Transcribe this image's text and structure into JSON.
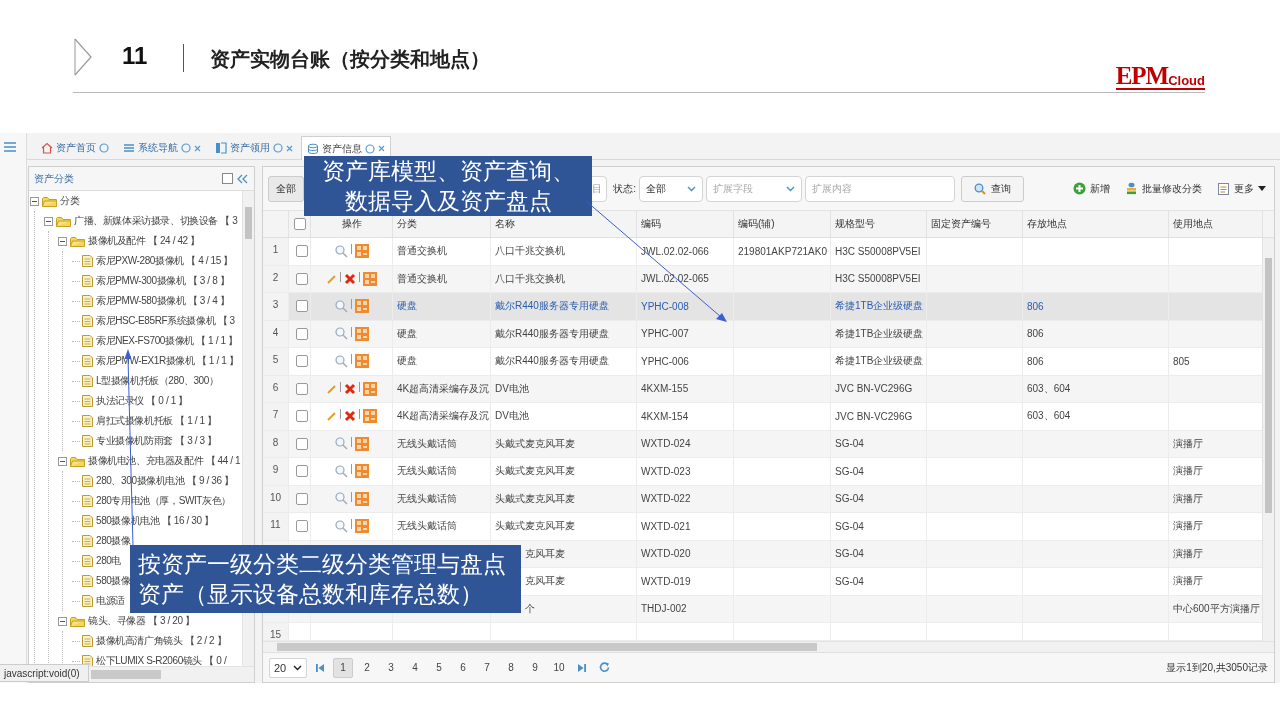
{
  "slide": {
    "number": "11",
    "title": "资产实物台账（按分类和地点）",
    "logo": {
      "main": "EPM",
      "sub": "Cloud"
    }
  },
  "app": {
    "tabs": [
      {
        "label": "资产首页",
        "closable": false,
        "selected": false
      },
      {
        "label": "系统导航",
        "closable": true,
        "selected": false
      },
      {
        "label": "资产领用",
        "closable": true,
        "selected": false
      },
      {
        "label": "资产信息",
        "closable": true,
        "selected": true
      }
    ],
    "tree_panel": {
      "title": "资产分类",
      "tree": [
        {
          "label": "分类",
          "kind": "folder",
          "expanded": true,
          "children": [
            {
              "label": "广播、新媒体采访摄录、切换设备 【 3",
              "kind": "folder",
              "expanded": true,
              "children": [
                {
                  "label": "摄像机及配件 【 24 / 42 】",
                  "kind": "folder",
                  "expanded": true,
                  "children": [
                    {
                      "label": "索尼PXW-280摄像机 【 4 / 15 】",
                      "kind": "file"
                    },
                    {
                      "label": "索尼PMW-300摄像机 【 3 / 8 】",
                      "kind": "file"
                    },
                    {
                      "label": "索尼PMW-580摄像机 【 3 / 4 】",
                      "kind": "file"
                    },
                    {
                      "label": "索尼HSC-E85RF系统摄像机 【 3",
                      "kind": "file"
                    },
                    {
                      "label": "索尼NEX-FS700摄像机 【 1 / 1 】",
                      "kind": "file"
                    },
                    {
                      "label": "索尼PMW-EX1R摄像机 【 1 / 1 】",
                      "kind": "file"
                    },
                    {
                      "label": "L型摄像机托板（280、300）",
                      "kind": "file"
                    },
                    {
                      "label": "执法记录仪 【 0 / 1 】",
                      "kind": "file"
                    },
                    {
                      "label": "肩扛式摄像机托板 【 1 / 1 】",
                      "kind": "file"
                    },
                    {
                      "label": "专业摄像机防雨套 【 3 / 3 】",
                      "kind": "file"
                    }
                  ]
                },
                {
                  "label": "摄像机电池、充电器及配件 【 44 / 1",
                  "kind": "folder",
                  "expanded": true,
                  "children": [
                    {
                      "label": "280、300摄像机电池 【 9 / 36 】",
                      "kind": "file"
                    },
                    {
                      "label": "280专用电池（厚，SWIT灰色）",
                      "kind": "file"
                    },
                    {
                      "label": "580摄像机电池 【 16 / 30 】",
                      "kind": "file"
                    },
                    {
                      "label": "280摄像",
                      "kind": "file"
                    },
                    {
                      "label": "280电",
                      "kind": "file"
                    },
                    {
                      "label": "580摄像",
                      "kind": "file"
                    },
                    {
                      "label": "电源适",
                      "kind": "file"
                    }
                  ]
                },
                {
                  "label": "镜头、寻像器 【 3 / 20 】",
                  "kind": "folder",
                  "expanded": true,
                  "children": [
                    {
                      "label": "摄像机高清广角镜头 【 2 / 2 】",
                      "kind": "file"
                    },
                    {
                      "label": "松下LUMIX S-R2060镜头 【 0 /",
                      "kind": "file"
                    }
                  ]
                }
              ]
            }
          ]
        }
      ]
    },
    "toolbar": {
      "all_button": "全部",
      "partial_field": {
        "value": "目"
      },
      "status": {
        "label": "状态:",
        "value": "全部"
      },
      "field_select": {
        "placeholder": "扩展字段"
      },
      "content_input": {
        "placeholder": "扩展内容"
      },
      "search_button": "查询",
      "actions": [
        {
          "label": "新增",
          "kind": "add"
        },
        {
          "label": "批量修改分类",
          "kind": "batch"
        },
        {
          "label": "更多",
          "kind": "more"
        }
      ]
    },
    "table": {
      "header_checked": false,
      "columns": [
        "操作",
        "分类",
        "名称",
        "编码",
        "编码(辅)",
        "规格型号",
        "固定资产编号",
        "存放地点",
        "使用地点"
      ],
      "rows": [
        {
          "number": "1",
          "kind": "view",
          "checked": false,
          "selected": false,
          "category": "普通交换机",
          "name": "八口千兆交换机",
          "code": "JWL.02.02-066",
          "code_aux": "219801AKP721AK0",
          "spec": "H3C S50008PV5EI"
        },
        {
          "number": "2",
          "kind": "edit",
          "checked": false,
          "selected": false,
          "category": "普通交换机",
          "name": "八口千兆交换机",
          "code": "JWL.02.02-065",
          "spec": "H3C S50008PV5EI"
        },
        {
          "number": "3",
          "kind": "view",
          "checked": false,
          "selected": true,
          "category": "硬盘",
          "name": "戴尔R440服务器专用硬盘",
          "code": "YPHC-008",
          "spec": "希捷1TB企业级硬盘",
          "location": "806"
        },
        {
          "number": "4",
          "kind": "view",
          "checked": false,
          "selected": false,
          "category": "硬盘",
          "name": "戴尔R440服务器专用硬盘",
          "code": "YPHC-007",
          "spec": "希捷1TB企业级硬盘",
          "location": "806"
        },
        {
          "number": "5",
          "kind": "view",
          "checked": false,
          "selected": false,
          "category": "硬盘",
          "name": "戴尔R440服务器专用硬盘",
          "code": "YPHC-006",
          "spec": "希捷1TB企业级硬盘",
          "location": "806",
          "use_location": "805"
        },
        {
          "number": "6",
          "kind": "edit",
          "checked": false,
          "selected": false,
          "category": "4K超高清采编存及沉",
          "name": "DV电池",
          "code": "4KXM-155",
          "spec": "JVC BN-VC296G",
          "location": "603、604"
        },
        {
          "number": "7",
          "kind": "edit",
          "checked": false,
          "selected": false,
          "category": "4K超高清采编存及沉",
          "name": "DV电池",
          "code": "4KXM-154",
          "spec": "JVC BN-VC296G",
          "location": "603、604"
        },
        {
          "number": "8",
          "kind": "view",
          "checked": false,
          "selected": false,
          "category": "无线头戴话筒",
          "name": "头戴式麦克风耳麦",
          "code": "WXTD-024",
          "spec": "SG-04",
          "use_location": "演播厅"
        },
        {
          "number": "9",
          "kind": "view",
          "checked": false,
          "selected": false,
          "category": "无线头戴话筒",
          "name": "头戴式麦克风耳麦",
          "code": "WXTD-023",
          "spec": "SG-04",
          "use_location": "演播厅"
        },
        {
          "number": "10",
          "kind": "view",
          "checked": false,
          "selected": false,
          "category": "无线头戴话筒",
          "name": "头戴式麦克风耳麦",
          "code": "WXTD-022",
          "spec": "SG-04",
          "use_location": "演播厅"
        },
        {
          "number": "11",
          "kind": "view",
          "checked": false,
          "selected": false,
          "category": "无线头戴话筒",
          "name": "头戴式麦克风耳麦",
          "code": "WXTD-021",
          "spec": "SG-04",
          "use_location": "演播厅"
        },
        {
          "selected": false,
          "name": "克风耳麦",
          "code": "WXTD-020",
          "spec": "SG-04",
          "use_location": "演播厅"
        },
        {
          "selected": false,
          "name": "克风耳麦",
          "code": "WXTD-019",
          "spec": "SG-04",
          "use_location": "演播厅"
        },
        {
          "selected": false,
          "name": "个",
          "code": "THDJ-002",
          "use_location": "中心600平方演播厅"
        },
        {
          "number": "15",
          "selected": false
        }
      ]
    },
    "pagination": {
      "page_size": "20",
      "pages": [
        {
          "label": "1",
          "selected": true
        },
        {
          "label": "2",
          "selected": false
        },
        {
          "label": "3",
          "selected": false
        },
        {
          "label": "4",
          "selected": false
        },
        {
          "label": "5",
          "selected": false
        },
        {
          "label": "6",
          "selected": false
        },
        {
          "label": "7",
          "selected": false
        },
        {
          "label": "8",
          "selected": false
        },
        {
          "label": "9",
          "selected": false
        },
        {
          "label": "10",
          "selected": false
        }
      ],
      "info": "显示1到20,共3050记录"
    },
    "status_text": "javascript:void(0)"
  },
  "callouts": [
    {
      "text": "资产库模型、资产查询、数据导入及资产盘点"
    },
    {
      "text": "按资产一级分类二级分类管理与盘点资产（显示设备总数和库存总数）"
    }
  ]
}
